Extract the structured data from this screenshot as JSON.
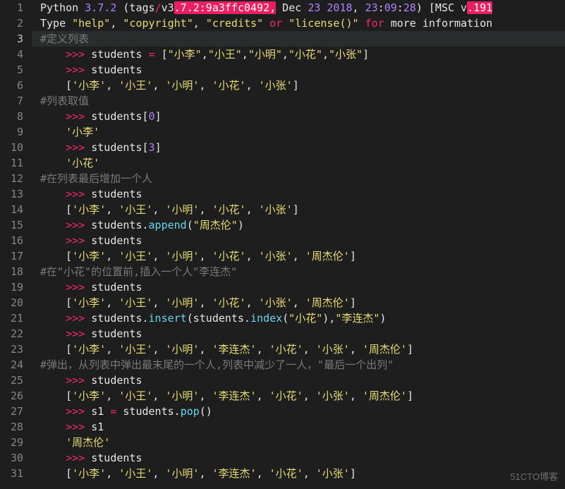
{
  "editor": {
    "active_line": 3,
    "lines": [
      {
        "n": 1,
        "tokens": [
          [
            "id",
            "Python "
          ],
          [
            "num",
            "3.7.2"
          ],
          [
            "id",
            " (tags"
          ],
          [
            "kw",
            "/"
          ],
          [
            "id",
            "v3"
          ],
          [
            "hl",
            ".7.2:9a3ffc0492,"
          ],
          [
            "id",
            " Dec "
          ],
          [
            "num",
            "23"
          ],
          [
            "id",
            " "
          ],
          [
            "num",
            "2018"
          ],
          [
            "id",
            ", "
          ],
          [
            "num",
            "23"
          ],
          [
            "id",
            ":"
          ],
          [
            "num",
            "09"
          ],
          [
            "id",
            ":"
          ],
          [
            "num",
            "28"
          ],
          [
            "id",
            ") [MSC v"
          ],
          [
            "hl",
            ".191"
          ]
        ]
      },
      {
        "n": 2,
        "tokens": [
          [
            "id",
            "Type "
          ],
          [
            "str",
            "\"help\""
          ],
          [
            "id",
            ", "
          ],
          [
            "str",
            "\"copyright\""
          ],
          [
            "id",
            ", "
          ],
          [
            "str",
            "\"credits\""
          ],
          [
            "id",
            " "
          ],
          [
            "kw",
            "or"
          ],
          [
            "id",
            " "
          ],
          [
            "str",
            "\"license()\""
          ],
          [
            "id",
            " "
          ],
          [
            "kw",
            "for"
          ],
          [
            "id",
            " more information"
          ]
        ]
      },
      {
        "n": 3,
        "tokens": [
          [
            "com",
            "#定义列表"
          ]
        ]
      },
      {
        "n": 4,
        "indent": "    ",
        "tokens": [
          [
            "op",
            ">>> "
          ],
          [
            "id",
            "students "
          ],
          [
            "op",
            "="
          ],
          [
            "id",
            " ["
          ],
          [
            "str",
            "\"小李\""
          ],
          [
            "id",
            ","
          ],
          [
            "str",
            "\"小王\""
          ],
          [
            "id",
            ","
          ],
          [
            "str",
            "\"小明\""
          ],
          [
            "id",
            ","
          ],
          [
            "str",
            "\"小花\""
          ],
          [
            "id",
            ","
          ],
          [
            "str",
            "\"小张\""
          ],
          [
            "id",
            "]"
          ]
        ]
      },
      {
        "n": 5,
        "indent": "    ",
        "tokens": [
          [
            "op",
            ">>> "
          ],
          [
            "id",
            "students"
          ]
        ]
      },
      {
        "n": 6,
        "indent": "    ",
        "tokens": [
          [
            "id",
            "["
          ],
          [
            "str",
            "'小李'"
          ],
          [
            "id",
            ", "
          ],
          [
            "str",
            "'小王'"
          ],
          [
            "id",
            ", "
          ],
          [
            "str",
            "'小明'"
          ],
          [
            "id",
            ", "
          ],
          [
            "str",
            "'小花'"
          ],
          [
            "id",
            ", "
          ],
          [
            "str",
            "'小张'"
          ],
          [
            "id",
            "]"
          ]
        ]
      },
      {
        "n": 7,
        "tokens": [
          [
            "com",
            "#列表取值"
          ]
        ]
      },
      {
        "n": 8,
        "indent": "    ",
        "tokens": [
          [
            "op",
            ">>> "
          ],
          [
            "id",
            "students["
          ],
          [
            "num",
            "0"
          ],
          [
            "id",
            "]"
          ]
        ]
      },
      {
        "n": 9,
        "indent": "    ",
        "tokens": [
          [
            "str",
            "'小李'"
          ]
        ]
      },
      {
        "n": 10,
        "indent": "    ",
        "tokens": [
          [
            "op",
            ">>> "
          ],
          [
            "id",
            "students["
          ],
          [
            "num",
            "3"
          ],
          [
            "id",
            "]"
          ]
        ]
      },
      {
        "n": 11,
        "indent": "    ",
        "tokens": [
          [
            "str",
            "'小花'"
          ]
        ]
      },
      {
        "n": 12,
        "tokens": [
          [
            "com",
            "#在列表最后增加一个人"
          ]
        ]
      },
      {
        "n": 13,
        "indent": "    ",
        "tokens": [
          [
            "op",
            ">>> "
          ],
          [
            "id",
            "students"
          ]
        ]
      },
      {
        "n": 14,
        "indent": "    ",
        "tokens": [
          [
            "id",
            "["
          ],
          [
            "str",
            "'小李'"
          ],
          [
            "id",
            ", "
          ],
          [
            "str",
            "'小王'"
          ],
          [
            "id",
            ", "
          ],
          [
            "str",
            "'小明'"
          ],
          [
            "id",
            ", "
          ],
          [
            "str",
            "'小花'"
          ],
          [
            "id",
            ", "
          ],
          [
            "str",
            "'小张'"
          ],
          [
            "id",
            "]"
          ]
        ]
      },
      {
        "n": 15,
        "indent": "    ",
        "tokens": [
          [
            "op",
            ">>> "
          ],
          [
            "id",
            "students."
          ],
          [
            "fn",
            "append"
          ],
          [
            "id",
            "("
          ],
          [
            "str",
            "\"周杰伦\""
          ],
          [
            "id",
            ")"
          ]
        ]
      },
      {
        "n": 16,
        "indent": "    ",
        "tokens": [
          [
            "op",
            ">>> "
          ],
          [
            "id",
            "students"
          ]
        ]
      },
      {
        "n": 17,
        "indent": "    ",
        "tokens": [
          [
            "id",
            "["
          ],
          [
            "str",
            "'小李'"
          ],
          [
            "id",
            ", "
          ],
          [
            "str",
            "'小王'"
          ],
          [
            "id",
            ", "
          ],
          [
            "str",
            "'小明'"
          ],
          [
            "id",
            ", "
          ],
          [
            "str",
            "'小花'"
          ],
          [
            "id",
            ", "
          ],
          [
            "str",
            "'小张'"
          ],
          [
            "id",
            ", "
          ],
          [
            "str",
            "'周杰伦'"
          ],
          [
            "id",
            "]"
          ]
        ]
      },
      {
        "n": 18,
        "tokens": [
          [
            "com",
            "#在\"小花\"的位置前,插入一个人\"李连杰\""
          ]
        ]
      },
      {
        "n": 19,
        "indent": "    ",
        "tokens": [
          [
            "op",
            ">>> "
          ],
          [
            "id",
            "students"
          ]
        ]
      },
      {
        "n": 20,
        "indent": "    ",
        "tokens": [
          [
            "id",
            "["
          ],
          [
            "str",
            "'小李'"
          ],
          [
            "id",
            ", "
          ],
          [
            "str",
            "'小王'"
          ],
          [
            "id",
            ", "
          ],
          [
            "str",
            "'小明'"
          ],
          [
            "id",
            ", "
          ],
          [
            "str",
            "'小花'"
          ],
          [
            "id",
            ", "
          ],
          [
            "str",
            "'小张'"
          ],
          [
            "id",
            ", "
          ],
          [
            "str",
            "'周杰伦'"
          ],
          [
            "id",
            "]"
          ]
        ]
      },
      {
        "n": 21,
        "indent": "    ",
        "tokens": [
          [
            "op",
            ">>> "
          ],
          [
            "id",
            "students."
          ],
          [
            "fn",
            "insert"
          ],
          [
            "id",
            "(students."
          ],
          [
            "fn",
            "index"
          ],
          [
            "id",
            "("
          ],
          [
            "str",
            "\"小花\""
          ],
          [
            "id",
            "),"
          ],
          [
            "str",
            "\"李连杰\""
          ],
          [
            "id",
            ")"
          ]
        ]
      },
      {
        "n": 22,
        "indent": "    ",
        "tokens": [
          [
            "op",
            ">>> "
          ],
          [
            "id",
            "students"
          ]
        ]
      },
      {
        "n": 23,
        "indent": "    ",
        "tokens": [
          [
            "id",
            "["
          ],
          [
            "str",
            "'小李'"
          ],
          [
            "id",
            ", "
          ],
          [
            "str",
            "'小王'"
          ],
          [
            "id",
            ", "
          ],
          [
            "str",
            "'小明'"
          ],
          [
            "id",
            ", "
          ],
          [
            "str",
            "'李连杰'"
          ],
          [
            "id",
            ", "
          ],
          [
            "str",
            "'小花'"
          ],
          [
            "id",
            ", "
          ],
          [
            "str",
            "'小张'"
          ],
          [
            "id",
            ", "
          ],
          [
            "str",
            "'周杰伦'"
          ],
          [
            "id",
            "]"
          ]
        ]
      },
      {
        "n": 24,
        "tokens": [
          [
            "com",
            "#弹出，从列表中弹出最末尾的一个人,列表中减少了一人，\"最后一个出列\""
          ]
        ]
      },
      {
        "n": 25,
        "indent": "    ",
        "tokens": [
          [
            "op",
            ">>> "
          ],
          [
            "id",
            "students"
          ]
        ]
      },
      {
        "n": 26,
        "indent": "    ",
        "tokens": [
          [
            "id",
            "["
          ],
          [
            "str",
            "'小李'"
          ],
          [
            "id",
            ", "
          ],
          [
            "str",
            "'小王'"
          ],
          [
            "id",
            ", "
          ],
          [
            "str",
            "'小明'"
          ],
          [
            "id",
            ", "
          ],
          [
            "str",
            "'李连杰'"
          ],
          [
            "id",
            ", "
          ],
          [
            "str",
            "'小花'"
          ],
          [
            "id",
            ", "
          ],
          [
            "str",
            "'小张'"
          ],
          [
            "id",
            ", "
          ],
          [
            "str",
            "'周杰伦'"
          ],
          [
            "id",
            "]"
          ]
        ]
      },
      {
        "n": 27,
        "indent": "    ",
        "tokens": [
          [
            "op",
            ">>> "
          ],
          [
            "id",
            "s1 "
          ],
          [
            "op",
            "="
          ],
          [
            "id",
            " students."
          ],
          [
            "fn",
            "pop"
          ],
          [
            "id",
            "()"
          ]
        ]
      },
      {
        "n": 28,
        "indent": "    ",
        "tokens": [
          [
            "op",
            ">>> "
          ],
          [
            "id",
            "s1"
          ]
        ]
      },
      {
        "n": 29,
        "indent": "    ",
        "tokens": [
          [
            "str",
            "'周杰伦'"
          ]
        ]
      },
      {
        "n": 30,
        "indent": "    ",
        "tokens": [
          [
            "op",
            ">>> "
          ],
          [
            "id",
            "students"
          ]
        ]
      },
      {
        "n": 31,
        "indent": "    ",
        "tokens": [
          [
            "id",
            "["
          ],
          [
            "str",
            "'小李'"
          ],
          [
            "id",
            ", "
          ],
          [
            "str",
            "'小王'"
          ],
          [
            "id",
            ", "
          ],
          [
            "str",
            "'小明'"
          ],
          [
            "id",
            ", "
          ],
          [
            "str",
            "'李连杰'"
          ],
          [
            "id",
            ", "
          ],
          [
            "str",
            "'小花'"
          ],
          [
            "id",
            ", "
          ],
          [
            "str",
            "'小张'"
          ],
          [
            "id",
            "]"
          ]
        ]
      }
    ]
  },
  "watermark": "51CTO博客"
}
